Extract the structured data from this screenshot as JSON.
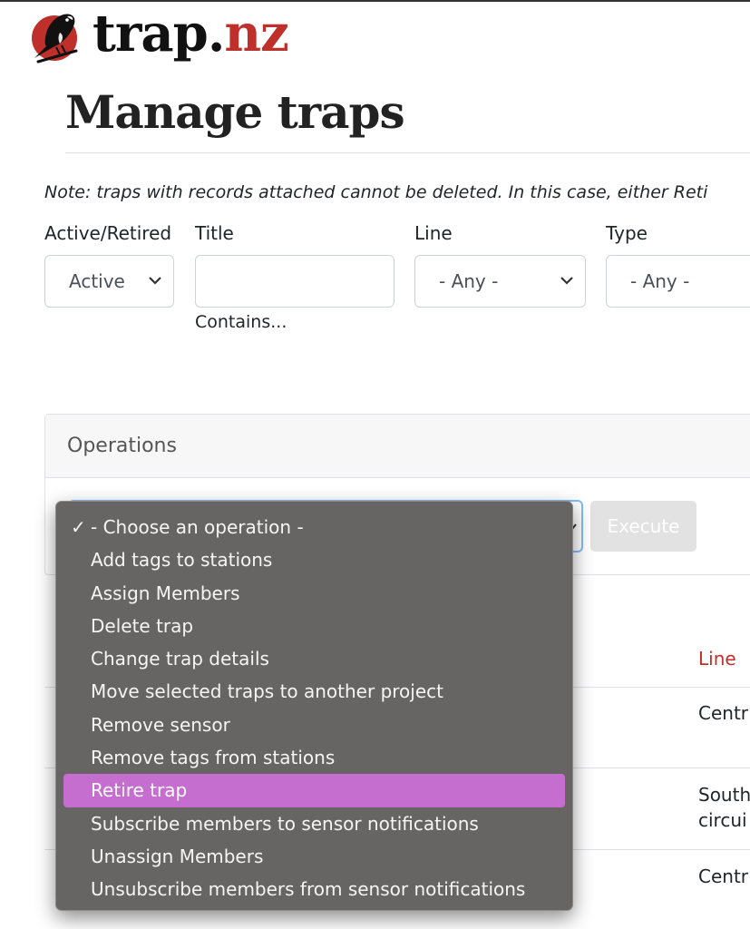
{
  "logo": {
    "text_dark": "trap.",
    "text_red": "nz"
  },
  "page": {
    "title": "Manage traps"
  },
  "note": "Note: traps with records attached cannot be deleted. In this case, either Reti",
  "filters": {
    "active_label": "Active/Retired",
    "active_value": "Active",
    "title_label": "Title",
    "title_value": "",
    "title_help": "Contains...",
    "line_label": "Line",
    "line_value": "- Any -",
    "type_label": "Type",
    "type_value": "- Any -"
  },
  "operations": {
    "header": "Operations",
    "execute_label": "Execute",
    "menu": [
      {
        "label": "- Choose an operation -",
        "checked": true
      },
      {
        "label": "Add tags to stations"
      },
      {
        "label": "Assign Members"
      },
      {
        "label": "Delete trap"
      },
      {
        "label": "Change trap details"
      },
      {
        "label": "Move selected traps to another project"
      },
      {
        "label": "Remove sensor"
      },
      {
        "label": "Remove tags from stations"
      },
      {
        "label": "Retire trap",
        "highlighted": true
      },
      {
        "label": "Subscribe members to sensor notifications"
      },
      {
        "label": "Unassign Members"
      },
      {
        "label": "Unsubscribe members from sensor notifications"
      }
    ]
  },
  "table": {
    "line_header": "Line",
    "rows": [
      {
        "line": "Centr"
      },
      {
        "line": "South",
        "line2": "circui"
      },
      {
        "line": "Centr"
      }
    ]
  },
  "colors": {
    "brand_red": "#c0302b",
    "highlight": "#c56ed0",
    "menu_bg": "#666563"
  }
}
